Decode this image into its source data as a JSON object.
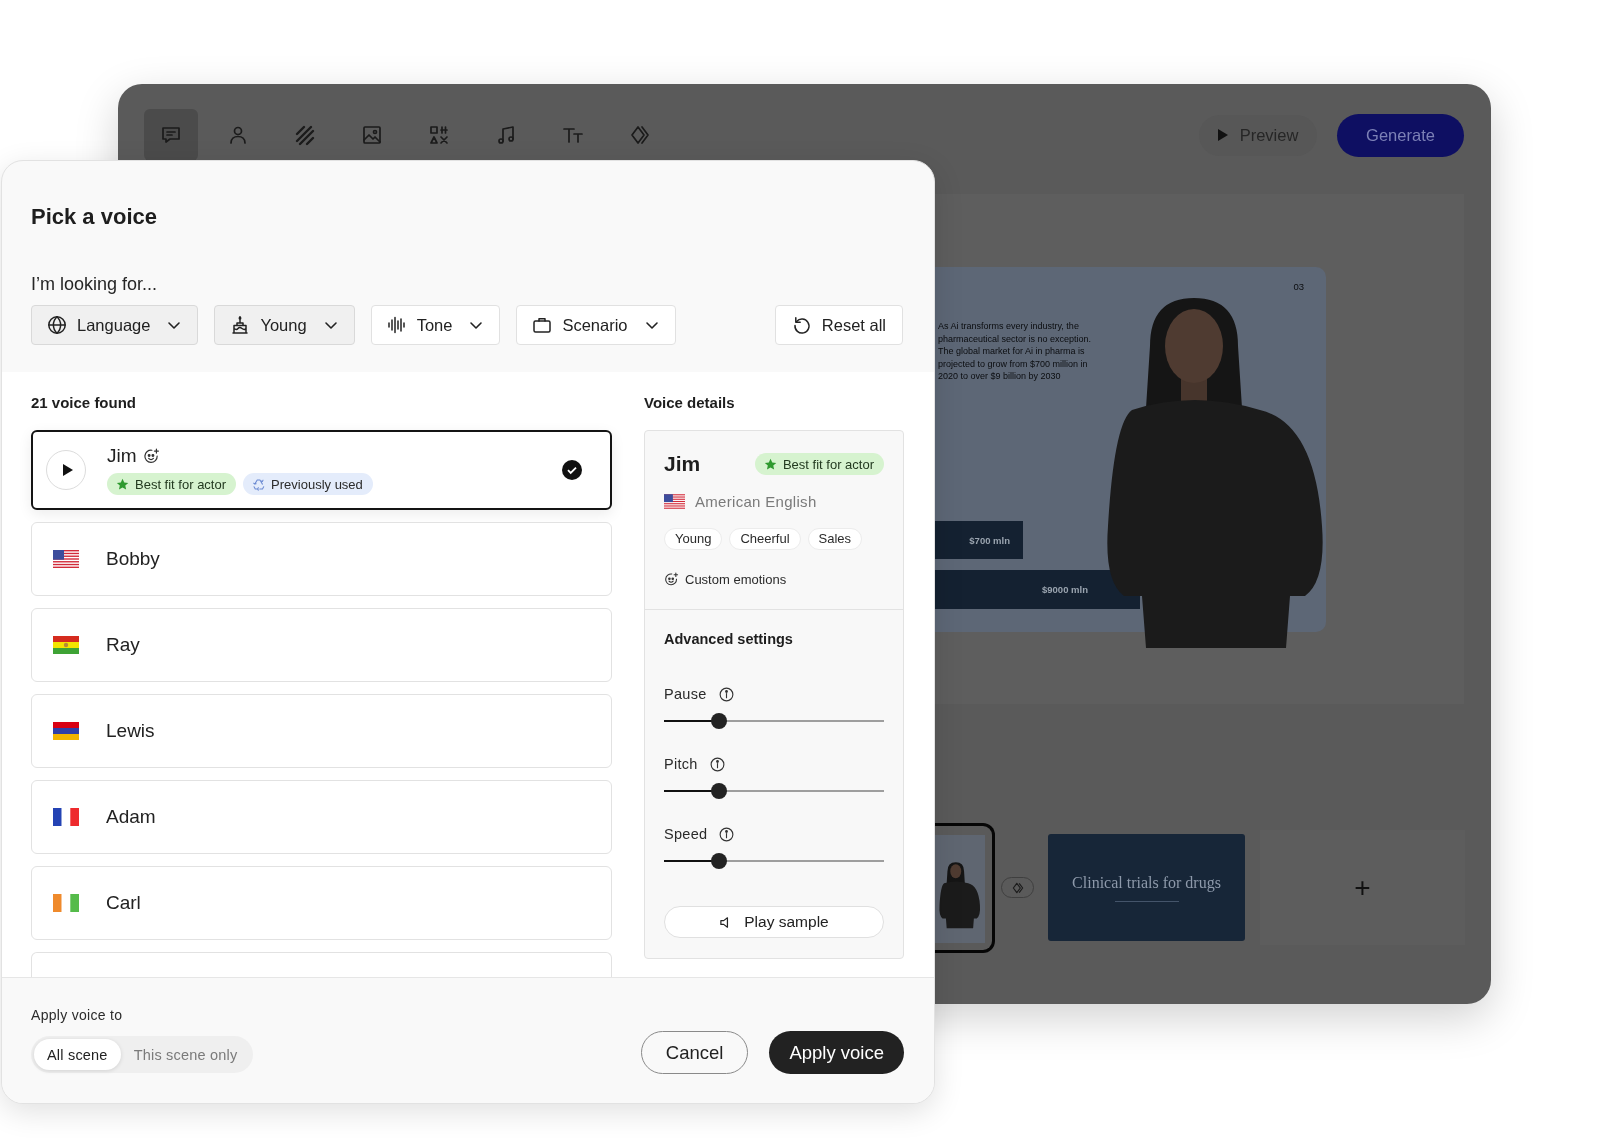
{
  "editor": {
    "toolbar": [
      {
        "kind": "chat",
        "selected": true
      },
      {
        "kind": "person",
        "selected": false
      },
      {
        "kind": "stripes",
        "selected": false
      },
      {
        "kind": "image",
        "selected": false
      },
      {
        "kind": "shapes",
        "selected": false
      },
      {
        "kind": "music",
        "selected": false
      },
      {
        "kind": "text",
        "selected": false
      },
      {
        "kind": "transition",
        "selected": false
      }
    ],
    "preview_button": "Preview",
    "generate_button": "Generate",
    "slide": {
      "number": "03",
      "text": "As Ai transforms every industry, the pharmaceutical sector is no exception. The global market for Ai in pharma is projected to grow from $700 million in 2020 to over $9 billion by 2030",
      "bars": [
        "$700 mln",
        "$9000 mln"
      ]
    },
    "scenes": [
      {
        "kind": "avatar",
        "selected": true
      },
      {
        "kind": "title",
        "title": "Clinical trials for drugs",
        "selected": false
      }
    ],
    "add_scene": "+"
  },
  "dialog": {
    "title": "Pick a voice",
    "prompt": "I’m looking for...",
    "filters": [
      {
        "kind": "language",
        "label": "Language",
        "active": true
      },
      {
        "kind": "age",
        "label": "Young",
        "active": true
      },
      {
        "kind": "tone",
        "label": "Tone",
        "active": false
      },
      {
        "kind": "scenario",
        "label": "Scenario",
        "active": false
      }
    ],
    "reset_button": "Reset all",
    "results": "21 voice found",
    "voices": [
      {
        "name": "Jim",
        "selected": true,
        "custom_emotions": true,
        "badges": [
          {
            "kind": "best_fit",
            "label": "Best fit for actor"
          },
          {
            "kind": "previously_used",
            "label": "Previously used"
          }
        ]
      },
      {
        "name": "Bobby",
        "flag": {
          "kind": "us"
        },
        "selected": false,
        "custom_emotions": false
      },
      {
        "name": "Ray",
        "flag": {
          "kind": "bo"
        },
        "selected": false,
        "custom_emotions": false
      },
      {
        "name": "Lewis",
        "flag": {
          "kind": "am"
        },
        "selected": false,
        "custom_emotions": false
      },
      {
        "name": "Adam",
        "flag": {
          "kind": "fr"
        },
        "selected": false,
        "custom_emotions": false
      },
      {
        "name": "Carl",
        "flag": {
          "kind": "ie"
        },
        "selected": false,
        "custom_emotions": false
      }
    ],
    "more_voices_below": true,
    "details": {
      "heading": "Voice details",
      "name": "Jim",
      "badge": {
        "kind": "best_fit",
        "label": "Best fit for actor"
      },
      "flag": {
        "kind": "us"
      },
      "language": "American English",
      "tags": [
        "Young",
        "Cheerful",
        "Sales"
      ],
      "emotions_label": "Custom emotions",
      "advanced_heading": "Advanced settings",
      "sliders": [
        {
          "label": "Pause",
          "level": 0.25
        },
        {
          "label": "Pitch",
          "level": 0.25
        },
        {
          "label": "Speed",
          "level": 0.25
        }
      ],
      "play_sample": "Play sample"
    },
    "apply_to": {
      "label": "Apply voice to",
      "options": [
        {
          "label": "All scene",
          "selected": true
        },
        {
          "label": "This scene only",
          "selected": false
        }
      ]
    },
    "cancel_button": "Cancel",
    "apply_button": "Apply voice"
  }
}
